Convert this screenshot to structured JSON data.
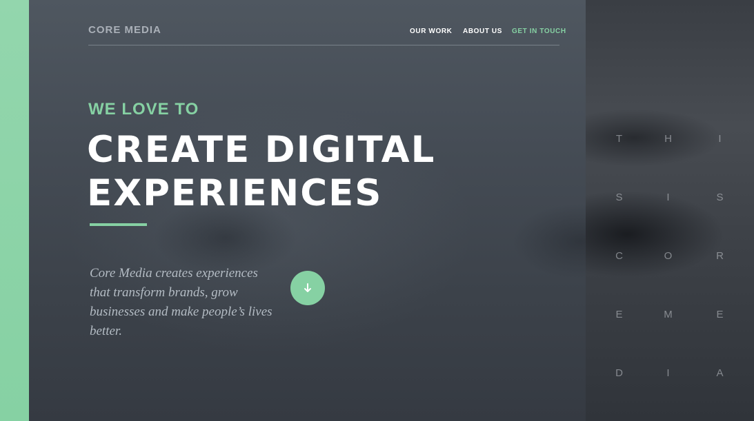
{
  "header": {
    "logo": "CORE MEDIA",
    "nav": [
      {
        "label": "OUR WORK"
      },
      {
        "label": "ABOUT US"
      },
      {
        "label": "GET IN TOUCH"
      }
    ]
  },
  "hero": {
    "eyebrow": "WE LOVE TO",
    "headline_lines": [
      "CREATE DIGITAL",
      "EXPERIENCES"
    ],
    "description": "Core Media creates experiences that transform brands, grow businesses and make people’s lives better.",
    "scroll_button_icon": "arrow-down-icon"
  },
  "side_panel": {
    "letters": [
      [
        "T",
        "H",
        "I"
      ],
      [
        "S",
        "I",
        "S"
      ],
      [
        "C",
        "O",
        "R"
      ],
      [
        "E",
        "M",
        "E"
      ],
      [
        "D",
        "I",
        "A"
      ]
    ]
  },
  "colors": {
    "accent": "#86d1a3",
    "hero_background": "#454c55",
    "headline": "#ffffff",
    "body_text": "#b4bcc4"
  }
}
